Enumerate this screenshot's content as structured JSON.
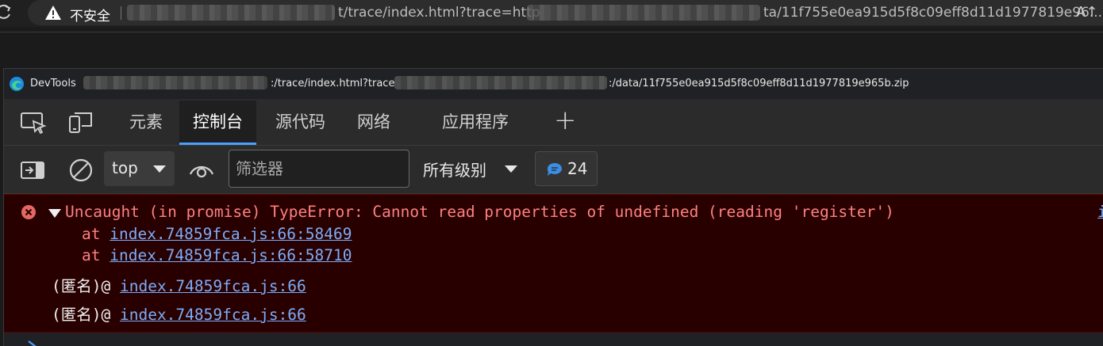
{
  "browser": {
    "security_label": "不安全",
    "url_visible_1": "t/trace/index.html?trace=http",
    "url_visible_2": "ta/11f755e0ea915d5f8c09eff8d11d1977819e96...",
    "read_aloud_glyph": "A↑"
  },
  "devtools_title": {
    "app": "DevTools",
    "url_part_1": ":/trace/index.html?trace",
    "url_part_2": ":/data/11f755e0ea915d5f8c09eff8d11d1977819e965b.zip"
  },
  "tabs": [
    {
      "label": "元素"
    },
    {
      "label": "控制台"
    },
    {
      "label": "源代码"
    },
    {
      "label": "网络"
    },
    {
      "label": "应用程序"
    }
  ],
  "tabs_add": "+",
  "toolbar": {
    "context": "top",
    "filter_placeholder": "筛选器",
    "levels": "所有级别",
    "message_count": "24"
  },
  "console_error": {
    "message": "Uncaught (in promise) TypeError: Cannot read properties of undefined (reading 'register')",
    "source_fragment": "i",
    "stack_at": "at",
    "stack": [
      "index.74859fca.js:66:58469",
      "index.74859fca.js:66:58710"
    ],
    "frames": [
      {
        "name": "(匿名)",
        "at": "@",
        "link": "index.74859fca.js:66"
      },
      {
        "name": "(匿名)",
        "at": "@",
        "link": "index.74859fca.js:66"
      }
    ]
  },
  "colors": {
    "error_background": "#290000",
    "error_text": "#ff8080",
    "link": "#7cacf8",
    "accent": "#4c9fff"
  },
  "icons": [
    "reload-icon",
    "warning-icon",
    "edge-logo-icon",
    "inspect-icon",
    "device-emulation-icon",
    "sidebar-toggle-icon",
    "clear-console-icon",
    "live-expression-icon",
    "message-icon",
    "error-icon"
  ]
}
